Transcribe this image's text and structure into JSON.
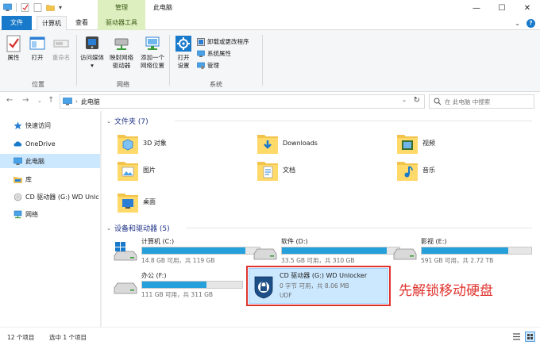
{
  "window": {
    "title": "此电脑",
    "context_tab_group": "管理",
    "buttons": {
      "minimize": "—",
      "maximize": "☐",
      "close": "✕"
    }
  },
  "tabs": {
    "file": "文件",
    "computer": "计算机",
    "view": "查看",
    "drive_tools": "驱动器工具"
  },
  "ribbon": {
    "location": {
      "label": "位置",
      "properties": "属性",
      "open": "打开",
      "rename": "重命名"
    },
    "network": {
      "label": "网络",
      "access_media": "访问媒体",
      "map_drive_line1": "映射网络",
      "map_drive_line2": "驱动器",
      "add_location_line1": "添加一个",
      "add_location_line2": "网络位置"
    },
    "system": {
      "label": "系统",
      "open_settings_line1": "打开",
      "open_settings_line2": "设置",
      "uninstall": "卸载或更改程序",
      "system_properties": "系统属性",
      "manage": "管理"
    }
  },
  "address": {
    "crumb": "此电脑",
    "search_placeholder": "在 此电脑 中搜索"
  },
  "nav": {
    "items": [
      {
        "label": "快速访问"
      },
      {
        "label": "OneDrive"
      },
      {
        "label": "此电脑"
      },
      {
        "label": "库"
      },
      {
        "label": "CD 驱动器 (G:) WD Unlc"
      },
      {
        "label": "网络"
      }
    ]
  },
  "folders": {
    "header": "文件夹 (7)",
    "items": [
      {
        "label": "3D 对象"
      },
      {
        "label": "Downloads"
      },
      {
        "label": "视频"
      },
      {
        "label": "图片"
      },
      {
        "label": "文档"
      },
      {
        "label": "音乐"
      },
      {
        "label": "桌面"
      }
    ]
  },
  "drives": {
    "header": "设备和驱动器 (5)",
    "items": [
      {
        "name": "计算机 (C:)",
        "info": "14.8 GB 可用，共 119 GB",
        "used_fraction": 0.876
      },
      {
        "name": "软件 (D:)",
        "info": "33.5 GB 可用，共 310 GB",
        "used_fraction": 0.892
      },
      {
        "name": "影视 (E:)",
        "info": "591 GB 可用，共 2.72 TB",
        "used_fraction": 0.788
      },
      {
        "name": "办公 (F:)",
        "info": "111 GB 可用，共 311 GB",
        "used_fraction": 0.643
      }
    ],
    "unlocker": {
      "name": "CD 驱动器 (G:) WD Unlocker",
      "info": "0 字节 可用，共 8.06 MB",
      "fs": "UDF"
    }
  },
  "annotation": "先解锁移动硬盘",
  "status": {
    "count": "12 个项目",
    "selected": "选中 1 个项目"
  },
  "colors": {
    "accent": "#1979ca",
    "drive_bar": "#26a0da",
    "selection": "#cce8ff",
    "annotation_red": "#e0322d",
    "context_tab": "#ddeebf"
  }
}
